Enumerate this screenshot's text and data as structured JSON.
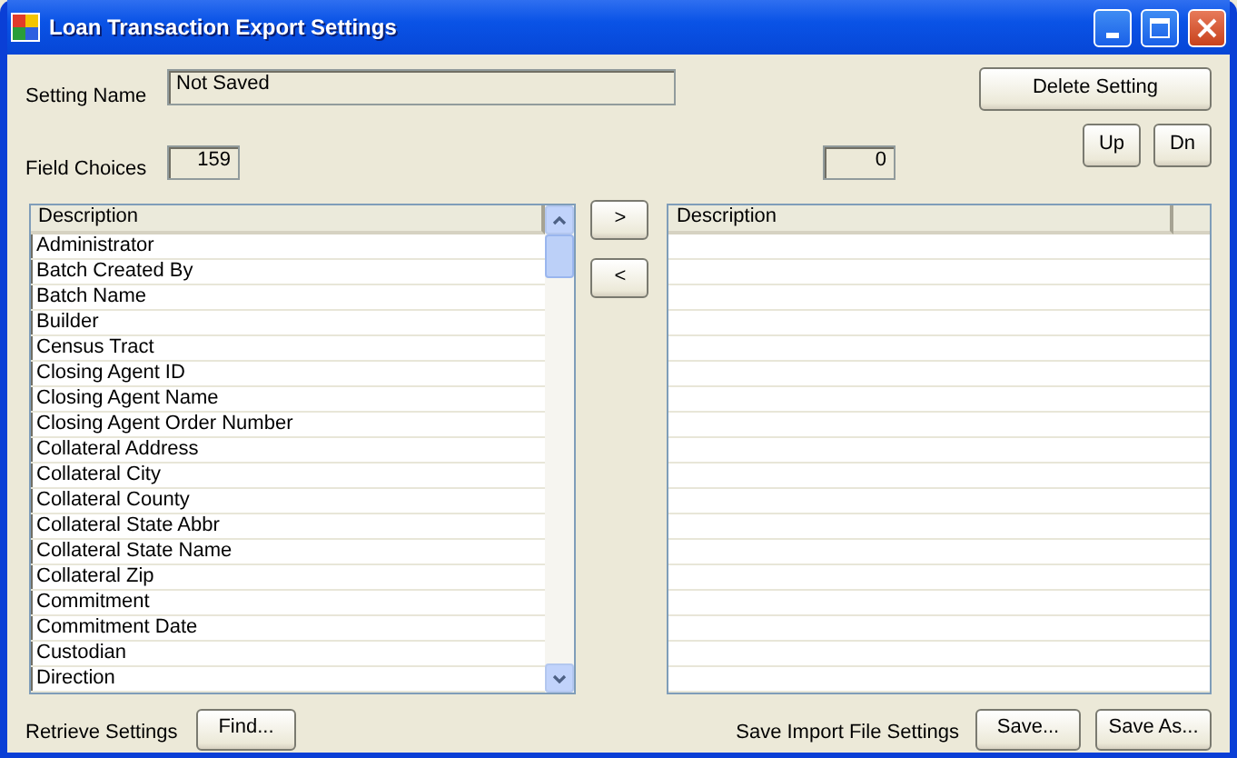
{
  "window": {
    "title": "Loan Transaction Export Settings"
  },
  "setting_name": {
    "label": "Setting Name",
    "value": "Not Saved"
  },
  "delete_button": "Delete Setting",
  "field_choices": {
    "label": "Field Choices",
    "count": "159"
  },
  "selected_count": "0",
  "order_buttons": [
    "Up",
    "Dn"
  ],
  "available_list": {
    "columns": [
      "Description"
    ],
    "rows": [
      "Administrator",
      "Batch Created By",
      "Batch Name",
      "Builder",
      "Census Tract",
      "Closing Agent ID",
      "Closing Agent Name",
      "Closing Agent Order Number",
      "Collateral Address",
      "Collateral City",
      "Collateral County",
      "Collateral State Abbr",
      "Collateral State Name",
      "Collateral Zip",
      "Commitment",
      "Commitment Date",
      "Custodian",
      "Direction"
    ]
  },
  "move_buttons": [
    ">",
    "<"
  ],
  "selected_list": {
    "columns": [
      "Description"
    ]
  },
  "retrieve": {
    "label": "Retrieve Settings",
    "button": "Find..."
  },
  "save": {
    "label": "Save Import File Settings",
    "buttons": [
      "Save...",
      "Save As..."
    ]
  }
}
